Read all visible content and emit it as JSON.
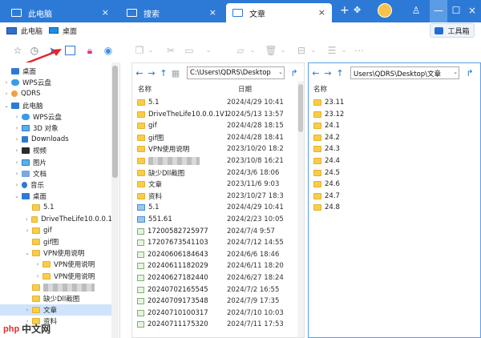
{
  "tabs": [
    {
      "label": "此电脑",
      "close": "×",
      "active": false
    },
    {
      "label": "搜索",
      "close": "×",
      "active": false
    },
    {
      "label": "文章",
      "close": "×",
      "active": true
    }
  ],
  "titlebar": {
    "add": "+",
    "pin": "⌂",
    "window_buttons": [
      "☐",
      "—",
      "☐",
      "×"
    ]
  },
  "breadcrumb": {
    "item1": "此电脑",
    "item2": "桌面"
  },
  "toolbox_label": "工具箱",
  "sidebar": [
    {
      "label": "桌面",
      "icon": "desktop-icon",
      "level": 0,
      "exp": ""
    },
    {
      "label": "WPS云盘",
      "icon": "cloud-icon",
      "level": 0,
      "exp": "›"
    },
    {
      "label": "QDRS",
      "icon": "user-icon",
      "level": 0,
      "exp": "›"
    },
    {
      "label": "此电脑",
      "icon": "computer-icon",
      "level": 0,
      "exp": "⌄"
    },
    {
      "label": "WPS云盘",
      "icon": "cloud-icon",
      "level": 1,
      "exp": "›"
    },
    {
      "label": "3D 对象",
      "icon": "cube-icon",
      "level": 1,
      "exp": "›"
    },
    {
      "label": "Downloads",
      "icon": "download-icon",
      "level": 1,
      "exp": "›"
    },
    {
      "label": "视频",
      "icon": "video-icon",
      "level": 1,
      "exp": "›"
    },
    {
      "label": "图片",
      "icon": "image-icon",
      "level": 1,
      "exp": "›"
    },
    {
      "label": "文档",
      "icon": "document-icon",
      "level": 1,
      "exp": "›"
    },
    {
      "label": "音乐",
      "icon": "music-icon",
      "level": 1,
      "exp": "›"
    },
    {
      "label": "桌面",
      "icon": "desktop-icon",
      "level": 1,
      "exp": "⌄"
    },
    {
      "label": "5.1",
      "icon": "folder-icon",
      "level": 2,
      "exp": ""
    },
    {
      "label": "DriveTheLife10.0.0.1",
      "icon": "folder-icon",
      "level": 2,
      "exp": "›"
    },
    {
      "label": "gif",
      "icon": "folder-icon",
      "level": 2,
      "exp": "›"
    },
    {
      "label": "gif图",
      "icon": "folder-icon",
      "level": 2,
      "exp": ""
    },
    {
      "label": "VPN使用说明",
      "icon": "folder-icon",
      "level": 2,
      "exp": "⌄"
    },
    {
      "label": "VPN使用说明",
      "icon": "folder-icon",
      "level": 3,
      "exp": "›"
    },
    {
      "label": "VPN使用说明",
      "icon": "folder-icon",
      "level": 3,
      "exp": "›"
    },
    {
      "label": "",
      "icon": "folder-icon",
      "level": 2,
      "exp": "",
      "blurred": true
    },
    {
      "label": "缺少Dll截图",
      "icon": "folder-icon",
      "level": 2,
      "exp": ""
    },
    {
      "label": "文章",
      "icon": "folder-icon",
      "level": 2,
      "exp": "›",
      "selected": true
    },
    {
      "label": "资料",
      "icon": "folder-icon",
      "level": 2,
      "exp": "›"
    }
  ],
  "left_panel": {
    "path": "C:\\Users\\QDRS\\Desktop",
    "col_name": "名称",
    "col_date": "日期",
    "rows": [
      {
        "name": "5.1",
        "date": "2024/4/29 10:41",
        "type": "folder"
      },
      {
        "name": "DriveTheLife10.0.0.1V17",
        "date": "2024/5/13 13:57",
        "type": "folder"
      },
      {
        "name": "gif",
        "date": "2024/4/28 18:15",
        "type": "folder"
      },
      {
        "name": "gif图",
        "date": "2024/4/28 18:41",
        "type": "folder"
      },
      {
        "name": "VPN使用说明",
        "date": "2023/10/20 18:2",
        "type": "folder"
      },
      {
        "name": "",
        "date": "2023/10/8 16:21",
        "type": "folder",
        "blurred": true
      },
      {
        "name": "缺少Dll截图",
        "date": "2024/3/6 18:06",
        "type": "folder"
      },
      {
        "name": "文章",
        "date": "2023/11/6 9:03",
        "type": "folder"
      },
      {
        "name": "资料",
        "date": "2023/10/27 18:3",
        "type": "folder"
      },
      {
        "name": "5.1",
        "date": "2024/4/29 10:41",
        "type": "media"
      },
      {
        "name": "551.61",
        "date": "2024/2/23 10:05",
        "type": "media"
      },
      {
        "name": "17200582725977",
        "date": "2024/7/4 9:57",
        "type": "file"
      },
      {
        "name": "17207673541103",
        "date": "2024/7/12 14:55",
        "type": "file"
      },
      {
        "name": "20240606184643",
        "date": "2024/6/6 18:46",
        "type": "file"
      },
      {
        "name": "20240611182029",
        "date": "2024/6/11 18:20",
        "type": "file"
      },
      {
        "name": "20240627182440",
        "date": "2024/6/27 18:24",
        "type": "file"
      },
      {
        "name": "20240702165545",
        "date": "2024/7/2 16:55",
        "type": "file"
      },
      {
        "name": "20240709173548",
        "date": "2024/7/9 17:35",
        "type": "file"
      },
      {
        "name": "20240710100317",
        "date": "2024/7/10 10:03",
        "type": "file"
      },
      {
        "name": "20240711175320",
        "date": "2024/7/11 17:53",
        "type": "file"
      }
    ]
  },
  "right_panel": {
    "path": "Users\\QDRS\\Desktop\\文章",
    "col_name": "名称",
    "rows": [
      "23.11",
      "23.12",
      "24.1",
      "24.2",
      "24.3",
      "24.4",
      "24.5",
      "24.6",
      "24.7",
      "24.8"
    ]
  },
  "watermark": {
    "logo": "php",
    "text": "中文网"
  }
}
